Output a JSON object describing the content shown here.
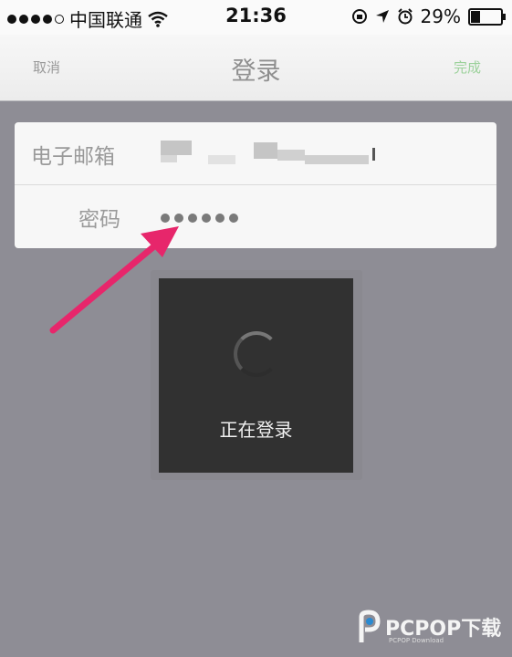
{
  "status_bar": {
    "carrier": "中国联通",
    "time": "21:36",
    "battery": "29%",
    "battery_level": 0.29,
    "signal_bars": 4,
    "icons": [
      "wifi-icon",
      "rotation-lock-icon",
      "location-arrow-icon",
      "alarm-icon",
      "battery-icon"
    ]
  },
  "nav": {
    "cancel_label": "取消",
    "title": "登录",
    "done_label": "完成"
  },
  "form": {
    "email_label": "电子邮箱",
    "password_label": "密码",
    "password_dots": 6
  },
  "hud": {
    "message": "正在登录"
  },
  "watermark": {
    "brand": "PCPOP下载",
    "sub": "PCPOP Download"
  },
  "colors": {
    "done": "#9bd19a",
    "annotation_arrow": "#e7266b",
    "background": "#8e8d95"
  }
}
